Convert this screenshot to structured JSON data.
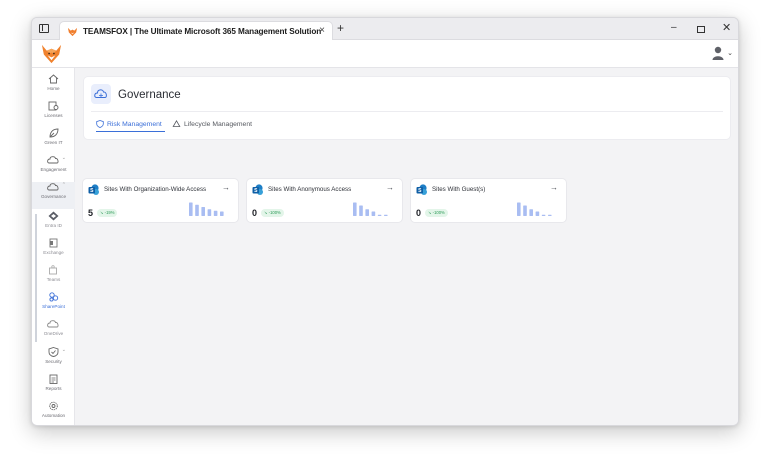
{
  "browser": {
    "tab_title": "TEAMSFOX | The Ultimate Microsoft 365 Management Solution",
    "tab_close": "×",
    "new_tab": "+",
    "minimize": "–",
    "close": "✕"
  },
  "app": {
    "avatar_caret": "⌄"
  },
  "sidebar": {
    "items": [
      {
        "label": "Home",
        "icon": "home-icon"
      },
      {
        "label": "Licenses",
        "icon": "license-icon"
      },
      {
        "label": "Green IT",
        "icon": "leaf-icon"
      },
      {
        "label": "Engagement",
        "icon": "engagement-icon"
      },
      {
        "label": "Governance",
        "icon": "cloud-icon"
      },
      {
        "label": "Entra ID",
        "icon": "entra-icon"
      },
      {
        "label": "Exchange",
        "icon": "exchange-icon"
      },
      {
        "label": "Teams",
        "icon": "teams-icon"
      },
      {
        "label": "SharePoint",
        "icon": "sharepoint-icon"
      },
      {
        "label": "OneDrive",
        "icon": "onedrive-icon"
      },
      {
        "label": "Security",
        "icon": "shield-icon"
      },
      {
        "label": "Reports",
        "icon": "report-icon"
      },
      {
        "label": "Automation",
        "icon": "gear-icon"
      }
    ]
  },
  "governance": {
    "title": "Governance",
    "tabs": [
      {
        "label": "Risk Management",
        "active": true
      },
      {
        "label": "Lifecycle Management",
        "active": false
      }
    ]
  },
  "metrics": [
    {
      "title": "Sites With Organization-Wide Access",
      "value": "5",
      "badge": "↘ -19%",
      "spark": [
        0.9,
        0.75,
        0.6,
        0.45,
        0.35,
        0.3
      ]
    },
    {
      "title": "Sites With Anonymous Access",
      "value": "0",
      "badge": "↘ -100%",
      "spark": [
        0.9,
        0.7,
        0.45,
        0.3,
        0.08,
        0.08
      ]
    },
    {
      "title": "Sites With Guest(s)",
      "value": "0",
      "badge": "↘ -100%",
      "spark": [
        0.9,
        0.7,
        0.45,
        0.3,
        0.08,
        0.08
      ]
    }
  ],
  "arrow": "→",
  "colors": {
    "accent": "#3b6fd8",
    "spark": "#a9bdf2",
    "badge_bg": "#e3f5e9",
    "badge_text": "#2c9a57"
  }
}
